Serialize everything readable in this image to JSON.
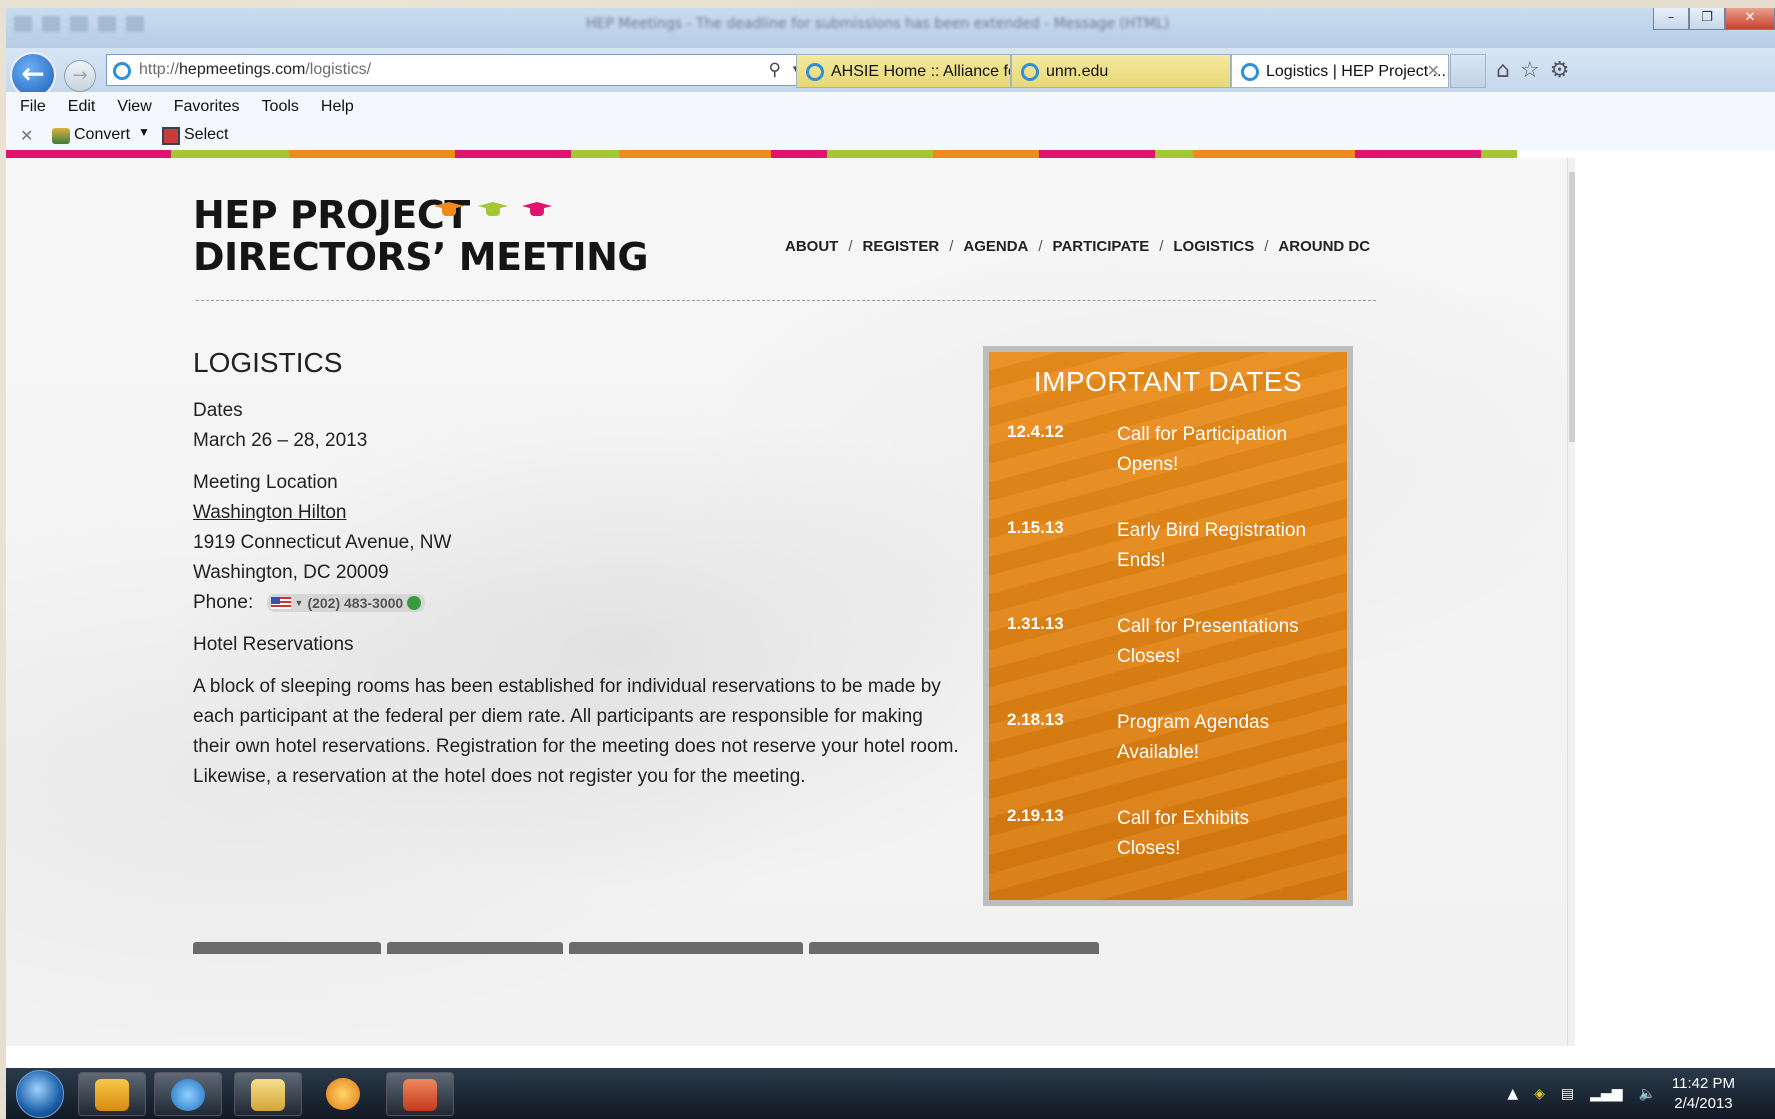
{
  "browser": {
    "window_title": "HEP Meetings - The deadline for submissions has been extended - Message (HTML)",
    "url_prefix": "http://",
    "url_domain": "hepmeetings.com",
    "url_path": "/logistics/",
    "tabs": [
      {
        "label": "AHSIE Home :: Alliance for...",
        "active": false
      },
      {
        "label": "unm.edu",
        "active": false
      },
      {
        "label": "Logistics | HEP Project ...",
        "active": true
      }
    ],
    "menu": [
      "File",
      "Edit",
      "View",
      "Favorites",
      "Tools",
      "Help"
    ],
    "command_bar": {
      "convert": "Convert",
      "select": "Select"
    }
  },
  "stripe_colors": [
    "#e0146f",
    "#a5c732",
    "#f08a1b",
    "#e0146f",
    "#a5c732",
    "#f08a1b",
    "#e0146f",
    "#a5c732",
    "#f08a1b",
    "#e0146f",
    "#a5c732",
    "#f08a1b",
    "#e0146f",
    "#a5c732"
  ],
  "site": {
    "logo_line1": "HEP PROJECT",
    "logo_line2": "DIRECTORS’ MEETING",
    "cap_colors": [
      "#f08a1b",
      "#a5c732",
      "#e0146f"
    ],
    "nav": [
      "ABOUT",
      "REGISTER",
      "AGENDA",
      "PARTICIPATE",
      "LOGISTICS",
      "AROUND DC"
    ]
  },
  "content": {
    "heading": "LOGISTICS",
    "dates_label": "Dates",
    "dates_value": "March 26 – 28, 2013",
    "location_label": "Meeting Location",
    "location_link": "Washington Hilton",
    "address1": "1919 Connecticut Avenue, NW",
    "address2": "Washington, DC 20009",
    "phone_label": "Phone:",
    "phone_number": "(202) 483-3000",
    "hotel_label": "Hotel Reservations",
    "hotel_text": "A block of sleeping rooms has been established for individual reservations to be made by each participant at the federal per diem rate.  All participants are responsible for making their own hotel reservations. Registration for the meeting does not reserve your hotel room. Likewise, a reservation at the hotel does not register you for the meeting."
  },
  "important_dates": {
    "title": "IMPORTANT DATES",
    "items": [
      {
        "date": "12.4.12",
        "event": "Call for Participation Opens!"
      },
      {
        "date": "1.15.13",
        "event": "Early Bird Registration Ends!"
      },
      {
        "date": "1.31.13",
        "event": "Call for Presentations Closes!"
      },
      {
        "date": "2.18.13",
        "event": "Program Agendas Available!"
      },
      {
        "date": "2.19.13",
        "event": "Call for Exhibits Closes!"
      }
    ]
  },
  "taskbar": {
    "time": "11:42 PM",
    "date": "2/4/2013"
  }
}
